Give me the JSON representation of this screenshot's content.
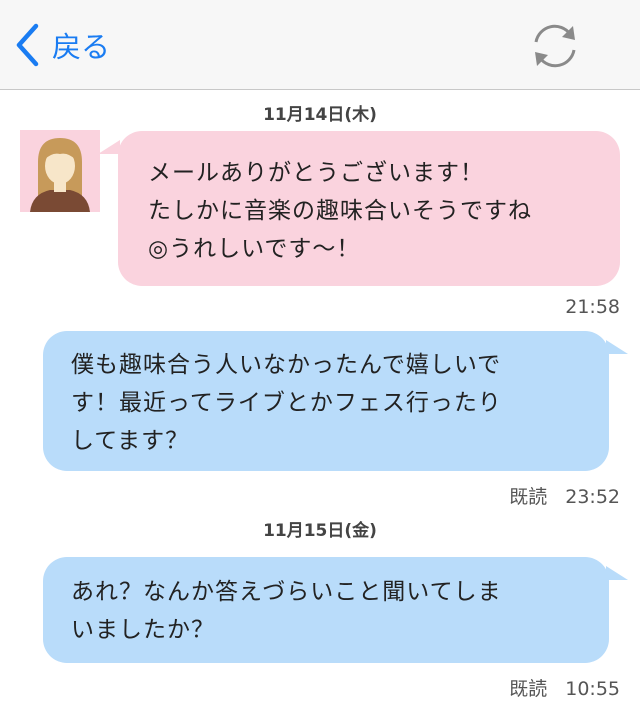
{
  "navbar": {
    "back_label": "戻る",
    "back_icon": "chevron-left-icon",
    "refresh_icon": "refresh-icon",
    "accent_color": "#1a7cf2"
  },
  "conversation": {
    "date_1": "11月14日(木)",
    "date_2": "11月15日(金)",
    "messages": [
      {
        "sender": "other",
        "lines": [
          "メールありがとうございます！",
          "たしかに音楽の趣味合いそうですね",
          "◎うれしいです〜！"
        ],
        "time": "21:58",
        "read": ""
      },
      {
        "sender": "self",
        "lines": [
          "僕も趣味合う人いなかったんで嬉しいで",
          "す！最近ってライブとかフェス行ったり",
          "してます？"
        ],
        "time": "23:52",
        "read": "既読"
      },
      {
        "sender": "self",
        "lines": [
          "あれ？なんか答えづらいこと聞いてしま",
          "いましたか？"
        ],
        "time": "10:55",
        "read": "既読"
      }
    ]
  },
  "colors": {
    "incoming_bubble": "#fad3de",
    "outgoing_bubble": "#b9dcfa"
  }
}
